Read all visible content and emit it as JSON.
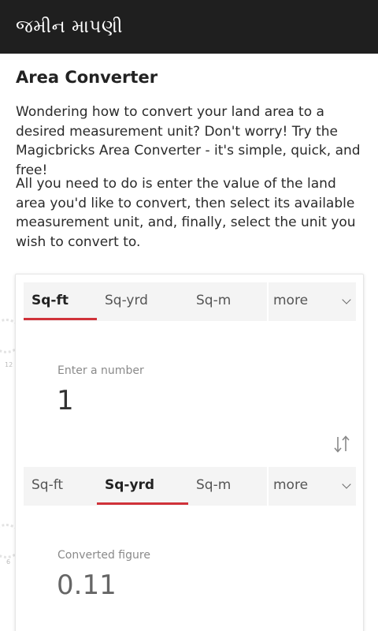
{
  "app_bar": {
    "title": "જમીન માપણી"
  },
  "page": {
    "title": "Area Converter",
    "intro_1": "Wondering how to convert your land area to a desired measurement unit? Don't worry! Try the Magicbricks Area Converter - it's simple, quick, and free!",
    "intro_2": "All you need to do is enter the value of the land area you'd like to convert, then select its available measurement unit, and, finally, select the unit you wish to convert to."
  },
  "decorations": {
    "gauge_mark_1": "12",
    "gauge_mark_2": "6"
  },
  "converter": {
    "from": {
      "tabs": [
        "Sq-ft",
        "Sq-yrd",
        "Sq-m"
      ],
      "selected": "Sq-ft",
      "more_label": "more",
      "input_label": "Enter a number",
      "input_value": "1"
    },
    "swap_icon": "swap-vertical-arrows-icon",
    "to": {
      "tabs": [
        "Sq-ft",
        "Sq-yrd",
        "Sq-m"
      ],
      "selected": "Sq-yrd",
      "more_label": "more",
      "output_label": "Converted figure",
      "output_value": "0.11"
    },
    "accent_color": "#d0323a"
  }
}
